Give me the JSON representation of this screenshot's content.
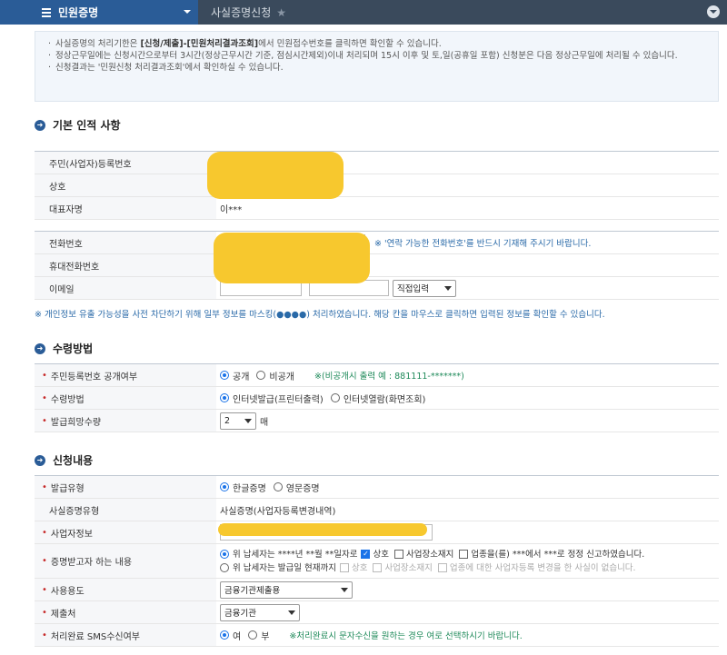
{
  "topbar": {
    "menu_title": "민원증명",
    "breadcrumb": "사실증명신청",
    "star": "★"
  },
  "notice": {
    "line1_pre": "사실증명의 처리기한은 ",
    "line1_bold": "[신청/제출]-[민원처리결과조회]",
    "line1_post": "에서 민원접수번호를 클릭하면 확인할 수 있습니다.",
    "line2": "정상근무일에는 신청시간으로부터 3시간(정상근무시간 기준, 점심시간제외)이내 처리되며 15시 이후 및 토,일(공휴일 포함) 신청분은 다음 정상근무일에 처리될 수 있습니다.",
    "line3": "신청결과는 '민원신청 처리결과조회'에서 확인하실 수 있습니다."
  },
  "section_basic": {
    "title": "기본 인적 사항",
    "rrn_label": "주민(사업자)등록번호",
    "company_label": "상호",
    "rep_label": "대표자명",
    "rep_value": "이***",
    "phone_label": "전화번호",
    "phone_hint": "※ '연락 가능한 전화번호'를 반드시 기재해 주시기 바랍니다.",
    "mobile_label": "휴대전화번호",
    "email_label": "이메일",
    "email_select": "직접입력",
    "mask_note": "※ 개인정보 유출 가능성을 사전 차단하기 위해 일부 정보를 마스킹(●●●●) 처리하였습니다. 해당 칸을 마우스로 클릭하면 입력된 정보를 확인할 수 있습니다."
  },
  "section_receive": {
    "title": "수령방법",
    "disclose_label": "주민등록번호 공개여부",
    "disclose_opt1": "공개",
    "disclose_opt2": "비공개",
    "disclose_hint": "※(비공개시 출력 예 : 881111-*******)",
    "method_label": "수령방법",
    "method_opt1": "인터넷발급(프린터출력)",
    "method_opt2": "인터넷열람(화면조회)",
    "qty_label": "발급희망수량",
    "qty_value": "2",
    "qty_unit": "매"
  },
  "section_apply": {
    "title": "신청내용",
    "type_label": "발급유형",
    "type_opt1": "한글증명",
    "type_opt2": "영문증명",
    "fact_label": "사실증명유형",
    "fact_value": "사실증명(사업자등록변경내역)",
    "biz_label": "사업자정보",
    "content_label": "증명받고자 하는 내용",
    "content_line1_pre": "위 납세자는 ****년 **월 **일자로",
    "content_line1_c1": "상호",
    "content_line1_c2": "사업장소재지",
    "content_line1_c3": "업종을(를) ***에서 ***로 정정 신고하였습니다.",
    "content_line2_pre": "위 납세자는 발급일 현재까지",
    "content_line2_c1": "상호",
    "content_line2_c2": "사업장소재지",
    "content_line2_c3": "업종에 대한 사업자등록 변경을 한 사실이 없습니다.",
    "purpose_label": "사용용도",
    "purpose_value": "금융기관제출용",
    "submit_label": "제출처",
    "submit_value": "금융기관",
    "sms_label": "처리완료 SMS수신여부",
    "sms_opt1": "여",
    "sms_opt2": "부",
    "sms_hint": "※처리완료시 문자수신을 원하는 경우 여로 선택하시기 바랍니다."
  },
  "colors": {
    "primary": "#2a5c97",
    "topbar": "#3a4a5c",
    "required": "#c62828",
    "hint_blue": "#2a6aa8",
    "mask_yellow": "#f7c82e"
  }
}
